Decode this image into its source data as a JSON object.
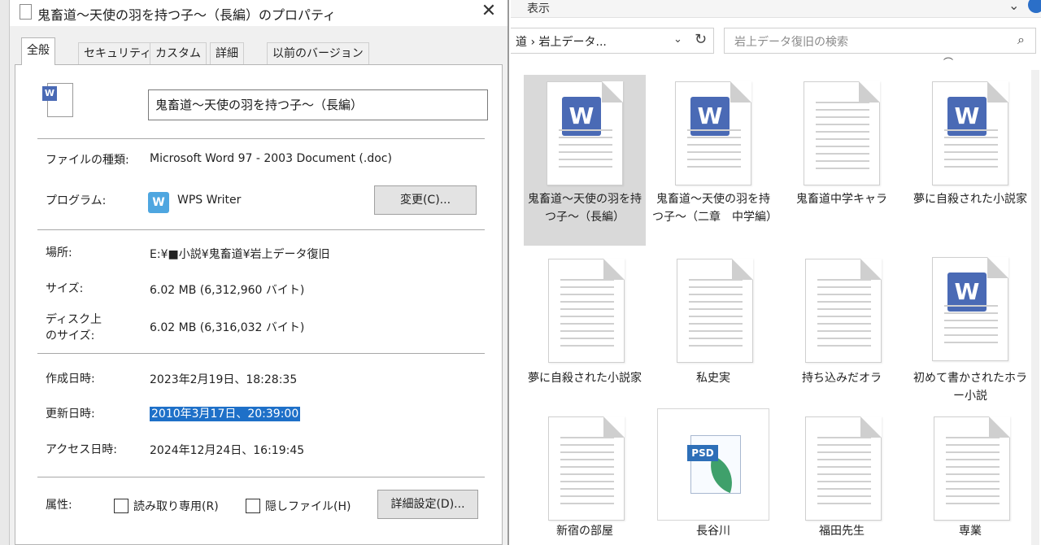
{
  "dialog": {
    "title": "鬼畜道〜天使の羽を持つ子〜（長編）のプロパティ",
    "close": "✕",
    "tabs": [
      "全般",
      "セキュリティ",
      "カスタム",
      "詳細",
      "以前のバージョン"
    ],
    "file_name": "鬼畜道〜天使の羽を持つ子〜（長編）",
    "file_type_label": "ファイルの種類:",
    "file_type_value": "Microsoft Word 97 - 2003 Document (.doc)",
    "program_label": "プログラム:",
    "program_value": "WPS Writer",
    "change_button": "変更(C)...",
    "location_label": "場所:",
    "location_value": "E:¥■小説¥鬼畜道¥岩上データ復旧",
    "size_label": "サイズ:",
    "size_value": "6.02 MB (6,312,960 バイト)",
    "disk_size_label_1": "ディスク上",
    "disk_size_label_2": "のサイズ:",
    "disk_size_value": "6.02 MB (6,316,032 バイト)",
    "created_label": "作成日時:",
    "created_value": "2023年2月19日、18:28:35",
    "modified_label": "更新日時:",
    "modified_value": "2010年3月17日、20:39:00",
    "accessed_label": "アクセス日時:",
    "accessed_value": "2024年12月24日、16:19:45",
    "attributes_label": "属性:",
    "readonly_label": "読み取り専用(R)",
    "hidden_label": "隠しファイル(H)",
    "advanced_button": "詳細設定(D)..."
  },
  "explorer": {
    "view_label": "表示",
    "breadcrumb": "道 › 岩上データ...",
    "search_placeholder": "岩上データ復旧の検索",
    "top_cut_text": "⌒",
    "files": [
      {
        "name": "鬼畜道〜天使の羽を持つ子〜（長編）",
        "icon": "word-doc-icon",
        "selected": true
      },
      {
        "name": "鬼畜道〜天使の羽を持つ子〜（二章　中学編）",
        "icon": "word-doc-icon"
      },
      {
        "name": "鬼畜道中学キャラ",
        "icon": "text-doc-icon"
      },
      {
        "name": "夢に自殺された小説家",
        "icon": "word-doc-icon"
      },
      {
        "name": "夢に自殺された小説家",
        "icon": "text-doc-icon"
      },
      {
        "name": "私史実",
        "icon": "text-doc-icon"
      },
      {
        "name": "持ち込みだオラ",
        "icon": "text-doc-icon"
      },
      {
        "name": "初めて書かされたホラー小説",
        "icon": "word-doc-icon"
      },
      {
        "name": "新宿の部屋",
        "icon": "text-doc-icon"
      },
      {
        "name": "長谷川",
        "icon": "psd-icon"
      },
      {
        "name": "福田先生",
        "icon": "text-doc-icon"
      },
      {
        "name": "専業",
        "icon": "text-doc-icon"
      }
    ],
    "word_badge": "W",
    "psd_badge": "PSD"
  }
}
